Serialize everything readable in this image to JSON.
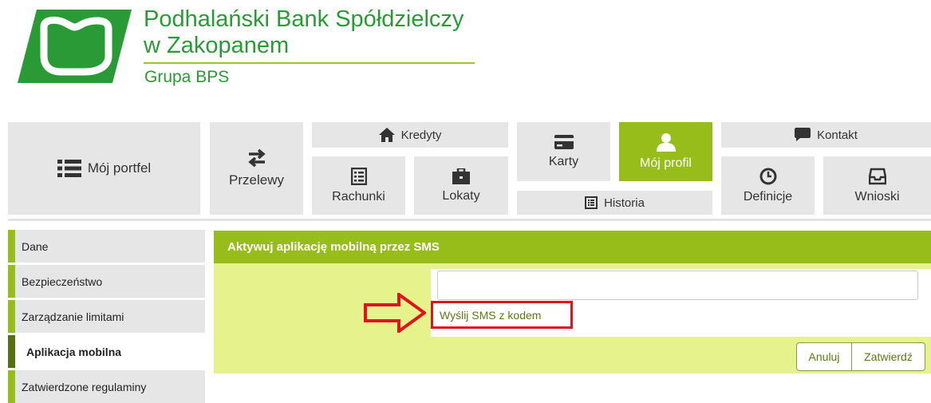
{
  "bank": {
    "name_line1": "Podhalański Bank Spółdzielczy",
    "name_line2": "w Zakopanem",
    "group": "Grupa BPS",
    "brand_color": "#2a9a37",
    "accent_color": "#97bd1a"
  },
  "nav": {
    "portfel": "Mój portfel",
    "przelewy": "Przelewy",
    "kredyty": "Kredyty",
    "rachunki": "Rachunki",
    "lokaty": "Lokaty",
    "karty": "Karty",
    "profil": "Mój profil",
    "historia": "Historia",
    "kontakt": "Kontakt",
    "definicje": "Definicje",
    "wnioski": "Wnioski"
  },
  "sidebar": {
    "items": [
      {
        "label": "Dane"
      },
      {
        "label": "Bezpieczeństwo"
      },
      {
        "label": "Zarządzanie limitami"
      },
      {
        "label": "Aplikacja mobilna"
      },
      {
        "label": "Zatwierdzone regulaminy"
      }
    ],
    "active": "Aplikacja mobilna"
  },
  "panel": {
    "title": "Aktywuj aplikację mobilną przez SMS",
    "code_value": "",
    "send_sms_label": "Wyślij SMS z kodem",
    "cancel_label": "Anuluj",
    "confirm_label": "Zatwierdź",
    "highlight_color": "#e0141e"
  }
}
